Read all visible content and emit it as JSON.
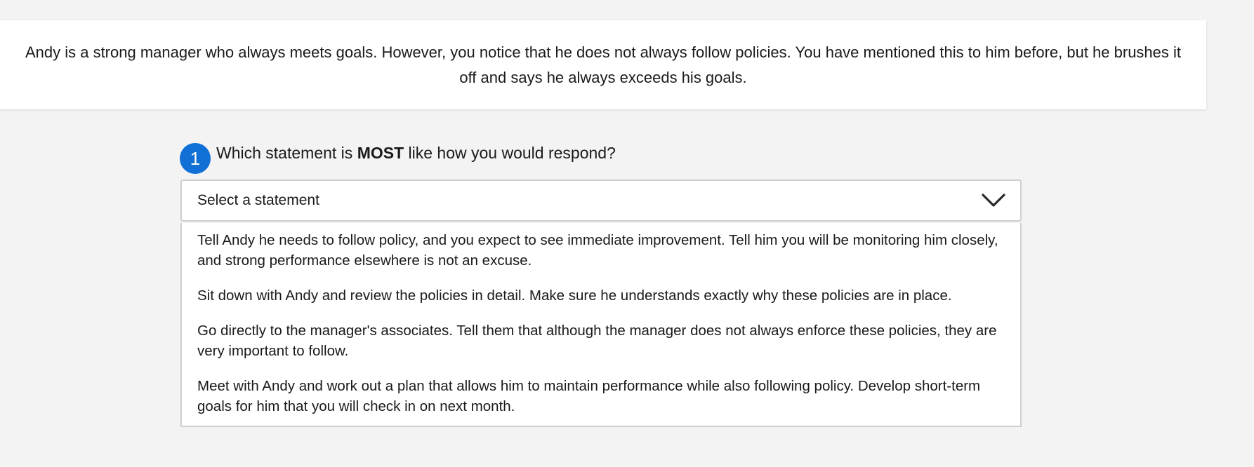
{
  "scenario": {
    "text": "Andy is a strong manager who always meets goals. However, you notice that he does not always follow policies. You have mentioned this to him before, but he brushes it off and says he always exceeds his goals."
  },
  "question": {
    "number": "1",
    "prefix": "Which statement is ",
    "emphasis": "MOST",
    "suffix": " like how you would respond?"
  },
  "select": {
    "placeholder": "Select a statement",
    "icon": "chevron-down-icon"
  },
  "options": [
    "Tell Andy he needs to follow policy, and you expect to see immediate improvement. Tell him you will be monitoring him closely, and strong performance elsewhere is not an excuse.",
    "Sit down with Andy and review the policies in detail. Make sure he understands exactly why these policies are in place.",
    "Go directly to the manager's associates. Tell them that although the manager does not always enforce these policies, they are very important to follow.",
    "Meet with Andy and work out a plan that allows him to maintain performance while also following policy. Develop short-term goals for him that you will check in on next month."
  ],
  "colors": {
    "accent": "#1170d6",
    "background": "#f3f3f3",
    "card": "#ffffff",
    "border": "#cfcfcf",
    "text": "#1a1a1a"
  }
}
